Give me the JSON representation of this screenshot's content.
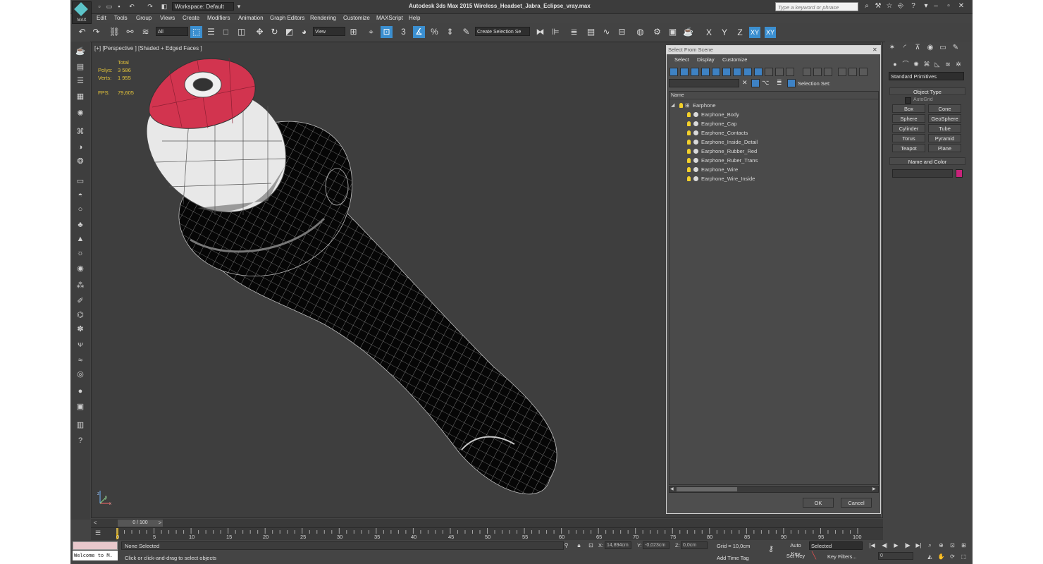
{
  "app": {
    "logo_text": "MAX",
    "title": "Autodesk 3ds Max  2015    Wireless_Headset_Jabra_Eclipse_vray.max",
    "workspace": "Workspace: Default",
    "search_placeholder": "Type a keyword or phrase"
  },
  "menu": [
    "Edit",
    "Tools",
    "Group",
    "Views",
    "Create",
    "Modifiers",
    "Animation",
    "Graph Editors",
    "Rendering",
    "Customize",
    "MAXScript",
    "Help"
  ],
  "toolbar": {
    "filter": "All",
    "ref_coord": "View",
    "snap_angle": "3",
    "selection_set": "Create Selection Se",
    "axes": [
      "X",
      "Y",
      "Z",
      "XY",
      "XY"
    ]
  },
  "viewport": {
    "label": "[+] [Perspective ] [Shaded + Edged Faces ]",
    "stats": {
      "total_label": "Total",
      "polys_label": "Polys:",
      "polys_value": "3 586",
      "verts_label": "Verts:",
      "verts_value": "1 955",
      "fps_label": "FPS:",
      "fps_value": "79,605"
    },
    "gizmo": {
      "x": "x",
      "y": "y",
      "z": "z"
    }
  },
  "explorer": {
    "title": "Select From Scene",
    "menus": [
      "Select",
      "Display",
      "Customize"
    ],
    "selection_set_label": "Selection Set:",
    "column_name": "Name",
    "root": "Earphone",
    "objects": [
      "Earphone_Body",
      "Earphone_Cap",
      "Earphone_Contacts",
      "Earphone_Inside_Detail",
      "Earphone_Rubber_Red",
      "Earphone_Ruber_Trans",
      "Earphone_Wire",
      "Earphone_Wire_Inside"
    ],
    "ok": "OK",
    "cancel": "Cancel"
  },
  "command_panel": {
    "category": "Standard Primitives",
    "object_type_title": "Object Type",
    "autogrid": "AutoGrid",
    "primitives": [
      "Box",
      "Cone",
      "Sphere",
      "GeoSphere",
      "Cylinder",
      "Tube",
      "Torus",
      "Pyramid",
      "Teapot",
      "Plane"
    ],
    "name_color_title": "Name and Color",
    "object_color": "#c8237a"
  },
  "timeline": {
    "frame": "0 / 100",
    "ticks": [
      "0",
      "5",
      "10",
      "15",
      "20",
      "25",
      "30",
      "35",
      "40",
      "45",
      "50",
      "55",
      "60",
      "65",
      "70",
      "75",
      "80",
      "85",
      "90",
      "95",
      "100"
    ]
  },
  "status": {
    "listener": "Welcome to M.",
    "selection": "None Selected",
    "prompt": "Click or click-and-drag to select objects",
    "x_label": "X:",
    "x": "14,894cm",
    "y_label": "Y:",
    "y": "-0,023cm",
    "z_label": "Z:",
    "z": "0,0cm",
    "grid": "Grid = 10,0cm",
    "add_time_tag": "Add Time Tag",
    "auto_key": "Auto Key",
    "set_key": "Set Key",
    "key_mode": "Selected",
    "key_filters": "Key Filters...",
    "frame_field": "0"
  }
}
